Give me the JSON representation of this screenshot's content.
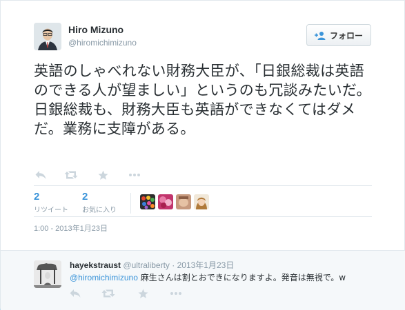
{
  "tweet": {
    "author_name": "Hiro Mizuno",
    "author_handle": "@hiromichimizuno",
    "follow_label": "フォロー",
    "text": "英語のしゃべれない財務大臣が、「日銀総裁は英語のできる人が望ましい」というのも冗談みたいだ。日銀総裁も、財務大臣も英語ができなくてはダメだ。業務に支障がある。",
    "actions": [
      "reply",
      "retweet",
      "favorite",
      "more"
    ],
    "retweets": {
      "count": "2",
      "label": "リツイート"
    },
    "favorites": {
      "count": "2",
      "label": "お気に入り"
    },
    "favoriters": [
      "favoriter-1",
      "favoriter-2",
      "favoriter-3",
      "favoriter-4"
    ],
    "timestamp": "1:00 - 2013年1月23日"
  },
  "reply": {
    "author_name": "hayekstraust",
    "author_handle": "@ultraliberty",
    "separator": " · ",
    "date": "2013年1月23日",
    "mention": "@hiromichimizuno",
    "text": " 麻生さんは割とおできになりますよ。発音は無視で。w"
  },
  "colors": {
    "link": "#3b94d9",
    "muted": "#8899a6",
    "icon": "#ccd6dd"
  }
}
